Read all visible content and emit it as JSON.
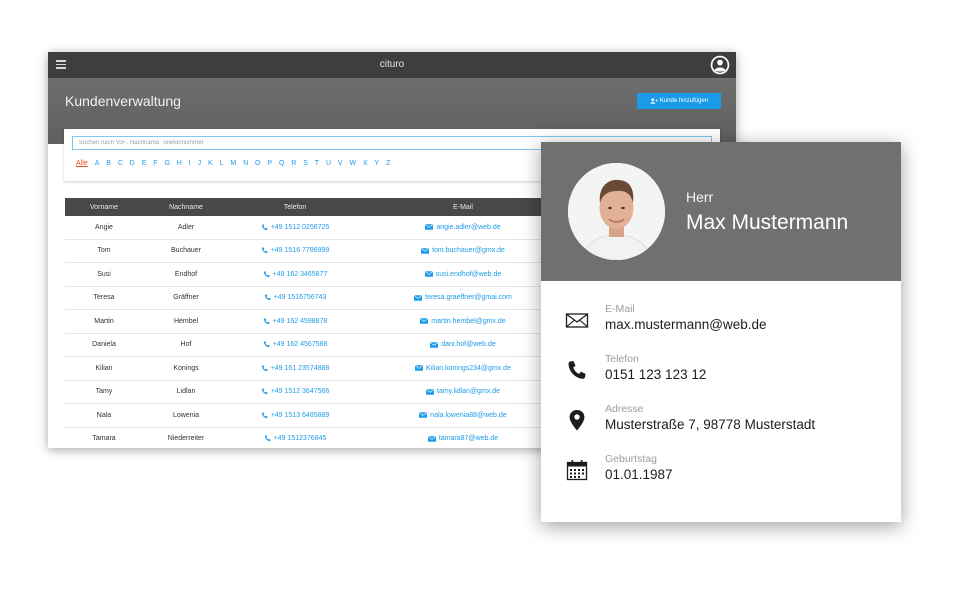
{
  "app": {
    "title": "cituro"
  },
  "header": {
    "title": "Kundenverwaltung",
    "add_button": "Kunde hinzufügen"
  },
  "search": {
    "placeholder": "Suchen nach Vor-, Nachname, Telefonnummer"
  },
  "alphabet": [
    "Alle",
    "A",
    "B",
    "C",
    "D",
    "E",
    "F",
    "G",
    "H",
    "I",
    "J",
    "K",
    "L",
    "M",
    "N",
    "O",
    "P",
    "Q",
    "R",
    "S",
    "T",
    "U",
    "V",
    "W",
    "X",
    "Y",
    "Z"
  ],
  "table": {
    "columns": [
      "Vorname",
      "Nachname",
      "Telefon",
      "E-Mail"
    ],
    "rows": [
      {
        "first": "Angie",
        "last": "Adler",
        "phone": "+49 1512 0256725",
        "email": "angie.adler@web.de"
      },
      {
        "first": "Tom",
        "last": "Buchauer",
        "phone": "+49 1516 7786999",
        "email": "tom.buchauer@gmx.de"
      },
      {
        "first": "Susi",
        "last": "Endhof",
        "phone": "+49 162 3465877",
        "email": "susi.endhof@web.de"
      },
      {
        "first": "Teresa",
        "last": "Gräffner",
        "phone": "+49 1516756743",
        "email": "teresa.graeffner@gmai.com"
      },
      {
        "first": "Martin",
        "last": "Hembel",
        "phone": "+49 162 4598878",
        "email": "martin.hembel@gmx.de"
      },
      {
        "first": "Daniela",
        "last": "Hof",
        "phone": "+49 162 4567588",
        "email": "dani.hof@web.de"
      },
      {
        "first": "Kilian",
        "last": "Konings",
        "phone": "+49 161 23574888",
        "email": "Kilian.konings234@gmx.de"
      },
      {
        "first": "Tamy",
        "last": "Lidlan",
        "phone": "+49 1512 3647566",
        "email": "tamy.lidlan@gmx.de"
      },
      {
        "first": "Nala",
        "last": "Lowenia",
        "phone": "+49 1513 6485889",
        "email": "nala.lowenia88@web.de"
      },
      {
        "first": "Tamara",
        "last": "Niederreiter",
        "phone": "+49 1512376845",
        "email": "tamara87@web.de"
      }
    ]
  },
  "contact": {
    "salutation": "Herr",
    "name": "Max Mustermann",
    "fields": [
      {
        "label": "E-Mail",
        "value": "max.mustermann@web.de",
        "icon": "envelope-icon"
      },
      {
        "label": "Telefon",
        "value": "0151 123 123 12",
        "icon": "phone-icon"
      },
      {
        "label": "Adresse",
        "value": "Musterstraße 7, 98778 Musterstadt",
        "icon": "location-pin-icon"
      },
      {
        "label": "Geburtstag",
        "value": "01.01.1987",
        "icon": "calendar-icon"
      }
    ]
  },
  "colors": {
    "accent": "#1a9be8",
    "active_letter": "#e84d1e",
    "topbar": "#3e3e3e",
    "card_header": "#707070"
  }
}
